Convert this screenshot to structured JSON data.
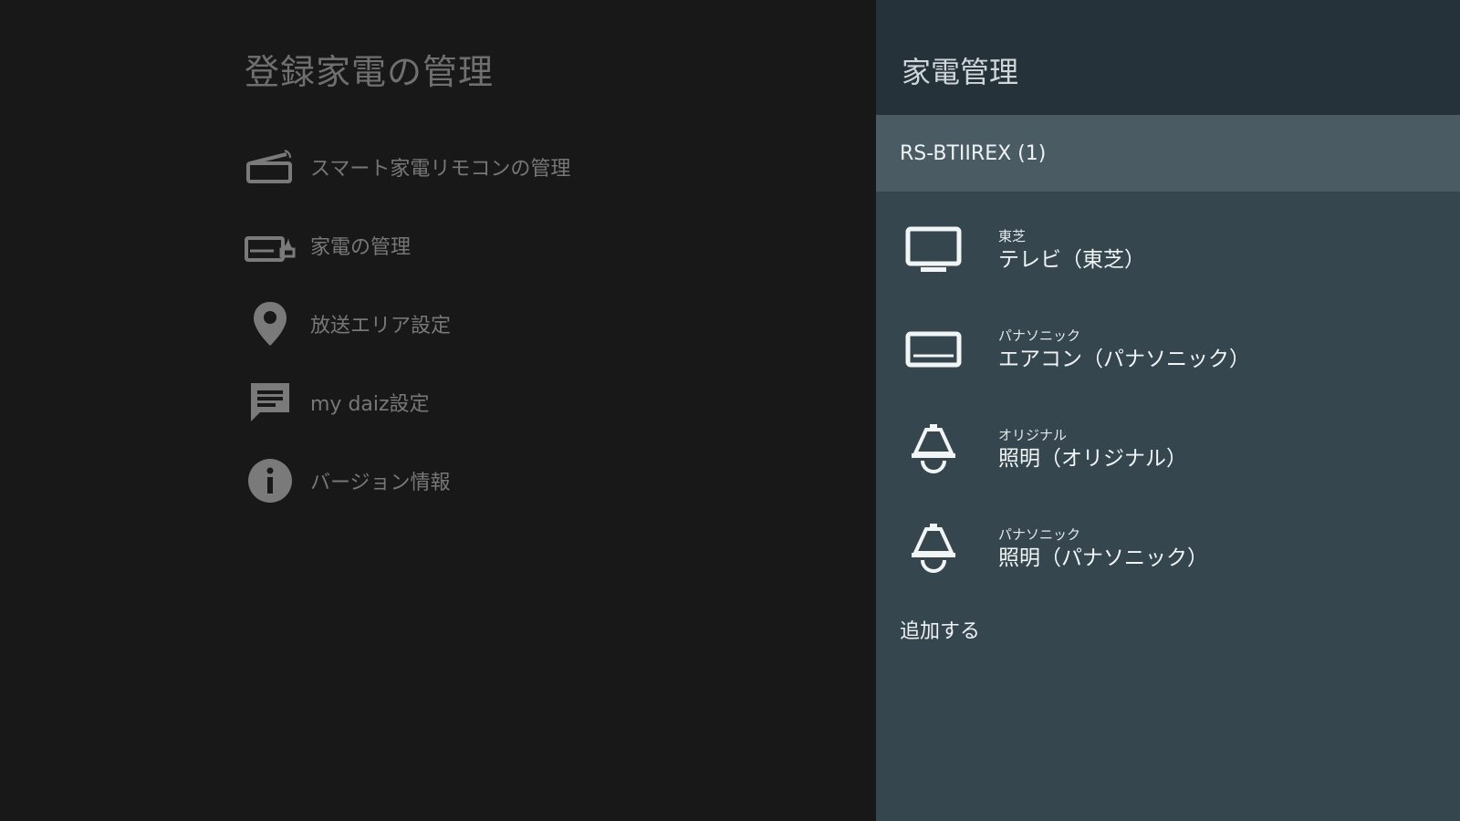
{
  "left": {
    "title": "登録家電の管理",
    "menu": [
      {
        "icon": "remote-router-icon",
        "label": "スマート家電リモコンの管理"
      },
      {
        "icon": "appliance-manage-icon",
        "label": "家電の管理"
      },
      {
        "icon": "location-pin-icon",
        "label": "放送エリア設定"
      },
      {
        "icon": "chat-message-icon",
        "label": "my daiz設定"
      },
      {
        "icon": "info-icon",
        "label": "バージョン情報"
      }
    ]
  },
  "right": {
    "title": "家電管理",
    "group": "RS-BTIIREX (1)",
    "devices": [
      {
        "icon": "tv-icon",
        "maker": "東芝",
        "name": "テレビ（東芝）"
      },
      {
        "icon": "air-conditioner-icon",
        "maker": "パナソニック",
        "name": "エアコン（パナソニック）"
      },
      {
        "icon": "ceiling-light-icon",
        "maker": "オリジナル",
        "name": "照明（オリジナル）"
      },
      {
        "icon": "ceiling-light-icon",
        "maker": "パナソニック",
        "name": "照明（パナソニック）"
      }
    ],
    "add_label": "追加する"
  },
  "colors": {
    "background": "#181818",
    "left_text": "#777777",
    "panel": "#36464f",
    "panel_header": "#263239",
    "group_header": "#4a5b63"
  }
}
